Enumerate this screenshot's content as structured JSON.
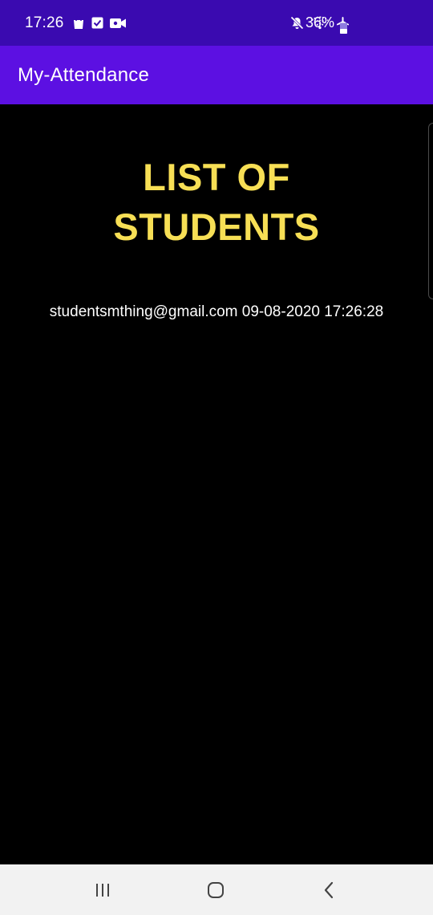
{
  "status_bar": {
    "time": "17:26",
    "battery_percent": "36%",
    "left_icons": [
      "shopping-bag-icon",
      "check-box-icon",
      "video-camera-icon"
    ],
    "right_icons": [
      "mute-icon",
      "wifi-icon",
      "airplane-icon",
      "battery-icon"
    ]
  },
  "app_bar": {
    "title": "My-Attendance"
  },
  "main": {
    "heading_line1": "LIST OF",
    "heading_line2": "STUDENTS",
    "records": [
      {
        "text": "studentsmthing@gmail.com 09-08-2020 17:26:28"
      }
    ]
  },
  "nav_bar": {
    "buttons": [
      "recents-icon",
      "home-icon",
      "back-icon"
    ]
  },
  "colors": {
    "status_bar": "#3a0ab0",
    "app_bar": "#5c10e2",
    "heading": "#f7df55",
    "background": "#000000",
    "nav_bar": "#f2f2f2"
  }
}
